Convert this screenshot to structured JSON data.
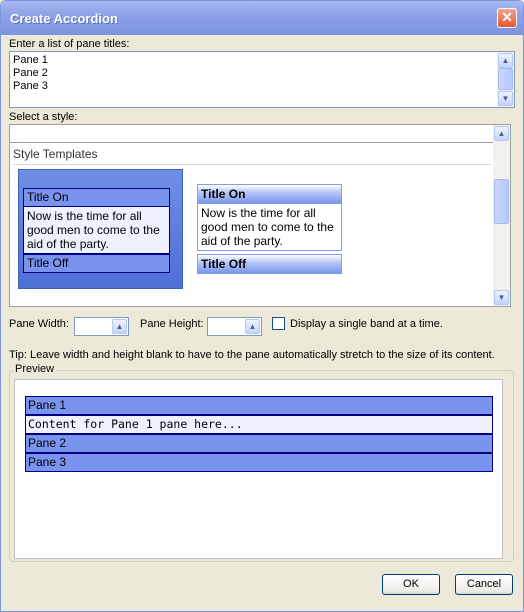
{
  "window": {
    "title": "Create Accordion",
    "close_glyph": "✕"
  },
  "pane_titles": {
    "label": "Enter a list of pane titles:",
    "lines": [
      "Pane 1",
      "Pane 2",
      "Pane 3"
    ]
  },
  "style": {
    "label": "Select a style:",
    "templates_header": "Style Templates",
    "template1": {
      "on": "Title On",
      "body": "Now is the time for all good men to come to the aid of the party.",
      "off": "Title Off"
    },
    "template2": {
      "on": "Title On",
      "body": "Now is the time for all good men to come to the aid of the party.",
      "off": "Title Off"
    }
  },
  "size": {
    "width_label": "Pane Width:",
    "height_label": "Pane Height:",
    "width_value": "",
    "height_value": "",
    "single_band_label": "Display a single band at a time.",
    "single_band_checked": false
  },
  "tip": "Tip: Leave width and height blank to have to the pane automatically stretch to the size of its content.",
  "preview": {
    "legend": "Preview",
    "rows": [
      {
        "text": "Pane 1",
        "kind": "head"
      },
      {
        "text": "Content for Pane 1 pane here...",
        "kind": "content"
      },
      {
        "text": "Pane 2",
        "kind": "head"
      },
      {
        "text": "Pane 3",
        "kind": "head"
      }
    ]
  },
  "buttons": {
    "ok": "OK",
    "cancel": "Cancel"
  },
  "icons": {
    "scroll_up": "▲",
    "scroll_down": "▼",
    "spin_up": "▲"
  },
  "colors": {
    "titlebar": "#8ea2e8",
    "band": "#7a93ee",
    "band_border": "#000080",
    "content_bg": "#eef1ff"
  }
}
